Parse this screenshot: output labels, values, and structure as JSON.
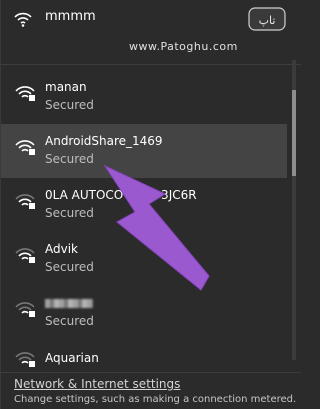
{
  "connected": {
    "name": "mmmm",
    "icon": "wifi-icon"
  },
  "watermark": "www.Patoghu.com",
  "logo_text": "تاپ",
  "networks": [
    {
      "ssid": "manan",
      "status": "Secured",
      "icon": "wifi-secured-icon"
    },
    {
      "ssid": "AndroidShare_1469",
      "status": "Secured",
      "icon": "wifi-secured-icon"
    },
    {
      "ssid": "0LA AUTOCO       T 3JC6R",
      "status": "Secured",
      "icon": "wifi-secured-icon"
    },
    {
      "ssid": "Advik",
      "status": "Secured",
      "icon": "wifi-secured-icon"
    },
    {
      "ssid": "",
      "status": "Secured",
      "icon": "wifi-secured-icon"
    },
    {
      "ssid": "Aquarian",
      "status": "",
      "icon": "wifi-secured-icon"
    }
  ],
  "settings": {
    "link": "Network & Internet settings",
    "desc": "Change settings, such as making a connection metered."
  },
  "colors": {
    "panel": "#2b2b2b",
    "selected": "#444444",
    "arrow": "#9b59d0"
  }
}
